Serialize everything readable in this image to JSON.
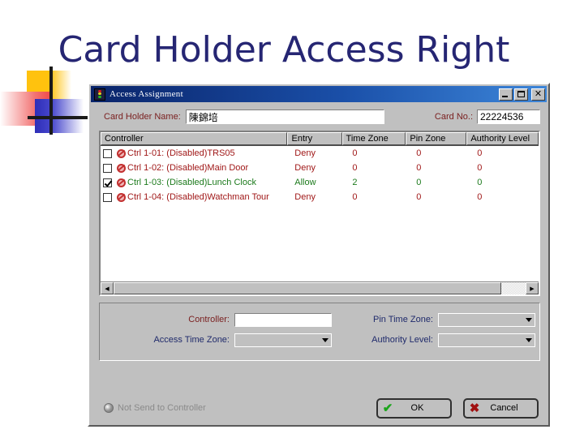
{
  "slide": {
    "title": "Card Holder Access Right",
    "title_color": "#262673",
    "decor": {
      "yellow": "#FFC20E",
      "red": "#F04A4A",
      "blue": "#2E2EB8",
      "cross": "#1a1a1a"
    }
  },
  "dialog": {
    "titlebar": {
      "text": "Access Assignment",
      "icon": "traffic-light-icon",
      "minimize_label": "_",
      "maximize_label": "□",
      "close_label": "✕"
    },
    "header_form": {
      "holder_name_label": "Card Holder Name:",
      "holder_name_value": "陳錦培",
      "card_no_label": "Card No.:",
      "card_no_value": "22224536"
    },
    "grid": {
      "columns": [
        "Controller",
        "Entry",
        "Time Zone",
        "Pin Zone",
        "Authority Level"
      ],
      "column_authority_truncated": "Authority Leve",
      "rows": [
        {
          "checked": false,
          "icon": "prohibited-icon",
          "controller": "Ctrl 1-01: (Disabled)TRS05",
          "entry": "Deny",
          "time_zone": "0",
          "pin_zone": "0",
          "authority_level": "0",
          "state": "deny"
        },
        {
          "checked": false,
          "icon": "prohibited-icon",
          "controller": "Ctrl 1-02: (Disabled)Main Door",
          "entry": "Deny",
          "time_zone": "0",
          "pin_zone": "0",
          "authority_level": "0",
          "state": "deny"
        },
        {
          "checked": true,
          "icon": "prohibited-icon",
          "controller": "Ctrl 1-03: (Disabled)Lunch Clock",
          "entry": "Allow",
          "time_zone": "2",
          "pin_zone": "0",
          "authority_level": "0",
          "state": "allow"
        },
        {
          "checked": false,
          "icon": "prohibited-icon",
          "controller": "Ctrl 1-04: (Disabled)Watchman Tour",
          "entry": "Deny",
          "time_zone": "0",
          "pin_zone": "0",
          "authority_level": "0",
          "state": "deny"
        }
      ],
      "scroll_left_glyph": "◀",
      "scroll_right_glyph": "▶"
    },
    "detail_panel": {
      "controller_label": "Controller:",
      "controller_value": "",
      "access_time_zone_label": "Access Time Zone:",
      "access_time_zone_value": "",
      "pin_time_zone_label": "Pin Time Zone:",
      "pin_time_zone_value": "",
      "authority_level_label": "Authority Level:",
      "authority_level_value": ""
    },
    "footer": {
      "not_send_label": "Not Send to Controller",
      "ok_label": "OK",
      "ok_glyph": "✔",
      "cancel_label": "Cancel",
      "cancel_glyph": "✖"
    }
  },
  "colors": {
    "deny_text": "#a01818",
    "allow_text": "#1c7a1c",
    "label_maroon": "#7a2020",
    "label_navy": "#1f2a6b",
    "disabled_text": "#8a8a8a",
    "dialog_face": "#c0c0c0",
    "titlebar_start": "#0a246a",
    "titlebar_end": "#3d86d9"
  }
}
